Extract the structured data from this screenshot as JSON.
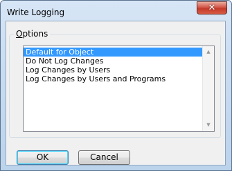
{
  "window": {
    "title": "Write Logging",
    "close_symbol": "✕"
  },
  "options": {
    "legend_access_key": "O",
    "legend_rest": "ptions",
    "items": [
      "Default for Object",
      "Do Not Log Changes",
      "Log Changes by Users",
      "Log Changes by Users and Programs"
    ],
    "selected_index": 0
  },
  "scrollbar": {
    "up_symbol": "▲",
    "down_symbol": "▼"
  },
  "buttons": {
    "ok": "OK",
    "cancel": "Cancel"
  },
  "colors": {
    "selection": "#3399ff",
    "close_button": "#c33a2a",
    "dialog_background": "#f0f0f0"
  }
}
